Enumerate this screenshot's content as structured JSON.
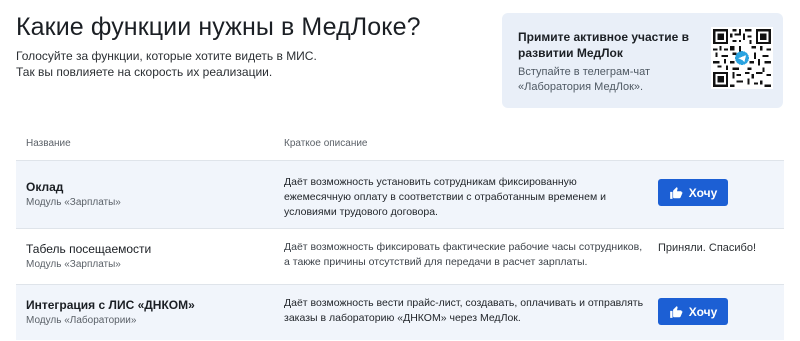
{
  "header": {
    "title": "Какие функции нужны в МедЛоке?",
    "subtitle_line1": "Голосуйте за функции, которые хотите видеть в МИС.",
    "subtitle_line2": "Так вы повлияете на скорость их реализации."
  },
  "promo": {
    "title": "Примите активное участие в развитии МедЛок",
    "text": "Вступайте в телеграм-чат «Лаборатория МедЛок».",
    "qr_icon": "qr-code-icon",
    "accent_color": "#2aa3e0",
    "background_color": "#e9eff8"
  },
  "table": {
    "headers": {
      "name": "Название",
      "description": "Краткое описание"
    },
    "rows": [
      {
        "title": "Оклад",
        "module": "Модуль «Зарплаты»",
        "description": "Даёт возможность установить сотрудникам фиксированную ежемесячную оплату в соответствии с отработанным временем и условиями трудового договора.",
        "action": "button",
        "button_label": "Хочу",
        "button_icon": "thumbs-up-icon"
      },
      {
        "title": "Табель посещаемости",
        "module": "Модуль «Зарплаты»",
        "description": "Даёт возможность фиксировать фактические рабочие часы сотрудников, а также причины отсутствий для передачи в расчет зарплаты.",
        "action": "status",
        "status_text": "Приняли. Спасибо!"
      },
      {
        "title": "Интеграция с ЛИС «ДНКОМ»",
        "module": "Модуль «Лаборатории»",
        "description": "Даёт возможность вести прайс-лист, создавать, оплачивать и отправлять заказы в лабораторию «ДНКОМ» через МедЛок.",
        "action": "button",
        "button_label": "Хочу",
        "button_icon": "thumbs-up-icon"
      }
    ]
  },
  "colors": {
    "primary_button": "#1c5fd4",
    "row_highlight": "#f1f5fb"
  }
}
